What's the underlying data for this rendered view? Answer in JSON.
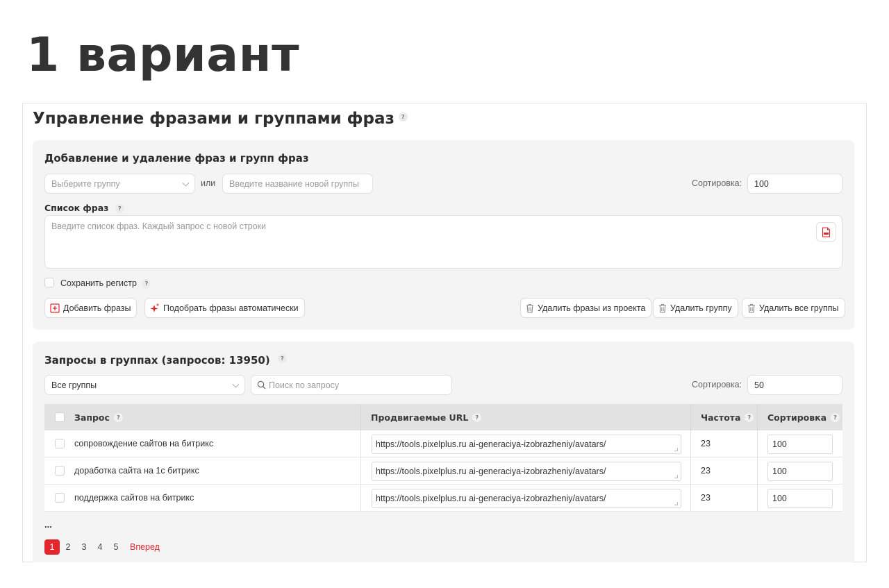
{
  "variant_title": "1 вариант",
  "main_title": "Управление фразами и группами фраз",
  "help_mark": "?",
  "add_section": {
    "title": "Добавление и удаление фраз и групп фраз",
    "group_select_placeholder": "Выберите группу",
    "or_label": "или",
    "new_group_placeholder": "Введите название новой группы",
    "sort_label": "Сортировка:",
    "sort_value": "100",
    "phrases_label": "Список фраз",
    "phrases_placeholder": "Введите список фраз. Каждый запрос с новой строки",
    "keep_case_label": "Сохранить регистр",
    "buttons": {
      "add": "Добавить фразы",
      "auto": "Подобрать фразы автоматически",
      "delete_phrases": "Удалить фразы из проекта",
      "delete_group": "Удалить группу",
      "delete_all_groups": "Удалить все группы"
    }
  },
  "queries_section": {
    "title": "Запросы в группах (запросов: 13950)",
    "group_filter_value": "Все группы",
    "search_placeholder": "Поиск по запросу",
    "sort_label": "Сортировка:",
    "sort_value": "50",
    "columns": {
      "query": "Запрос",
      "url": "Продвигаемые URL",
      "frequency": "Частота",
      "sort": "Сортировка"
    },
    "rows": [
      {
        "query": "сопровождение сайтов на битрикс",
        "url": "https://tools.pixelplus.ru ai-generaciya-izobrazheniy/avatars/",
        "frequency": "23",
        "sort": "100"
      },
      {
        "query": "доработка сайта на 1с битрикс",
        "url": "https://tools.pixelplus.ru ai-generaciya-izobrazheniy/avatars/",
        "frequency": "23",
        "sort": "100"
      },
      {
        "query": "поддержка сайтов на битрикс",
        "url": "https://tools.pixelplus.ru ai-generaciya-izobrazheniy/avatars/",
        "frequency": "23",
        "sort": "100"
      }
    ],
    "ellipsis": "...",
    "pagination": {
      "pages": [
        "1",
        "2",
        "3",
        "4",
        "5"
      ],
      "current": "1",
      "next_label": "Вперед"
    }
  },
  "colors": {
    "accent": "#e3262e",
    "panel_bg": "#f4f4f4",
    "header_bg": "#e2e2e2"
  },
  "icons": [
    "help-icon",
    "chevron-down-icon",
    "txt-file-icon",
    "plus-square-icon",
    "sparkle-icon",
    "trash-icon",
    "search-icon"
  ]
}
